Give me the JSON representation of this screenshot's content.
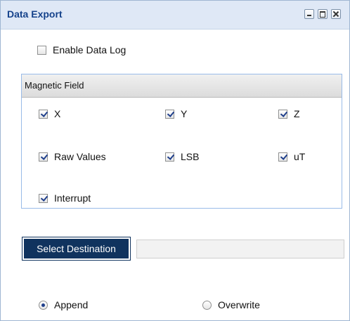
{
  "window": {
    "title": "Data Export"
  },
  "enable_log": {
    "label": "Enable Data Log",
    "checked": false
  },
  "magnetic_field": {
    "title": "Magnetic Field",
    "options": [
      {
        "label": "X",
        "checked": true
      },
      {
        "label": "Y",
        "checked": true
      },
      {
        "label": "Z",
        "checked": true
      },
      {
        "label": "Raw Values",
        "checked": true
      },
      {
        "label": "LSB",
        "checked": true
      },
      {
        "label": "uT",
        "checked": true
      },
      {
        "label": "Interrupt",
        "checked": true
      }
    ]
  },
  "destination": {
    "button_label": "Select Destination",
    "path_value": ""
  },
  "write_mode": {
    "options": [
      {
        "label": "Append",
        "selected": true
      },
      {
        "label": "Overwrite",
        "selected": false
      }
    ]
  },
  "colors": {
    "title_text": "#15428b",
    "titlebar_bg": "#dfe8f6",
    "button_bg": "#10335e"
  }
}
